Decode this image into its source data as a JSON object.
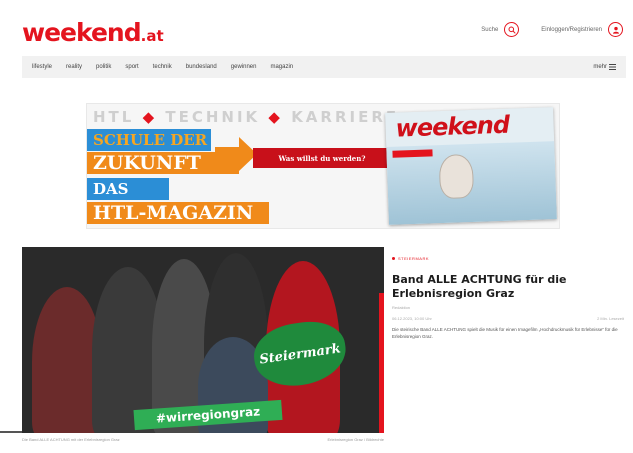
{
  "header": {
    "logo_main": "weekend",
    "logo_tld": ".at",
    "search_label": "Suche",
    "login_label": "Einloggen/Registrieren"
  },
  "nav": {
    "items": [
      "lifestyle",
      "reality",
      "politik",
      "sport",
      "technik",
      "bundesland",
      "gewinnen",
      "magazin"
    ],
    "more_label": "mehr"
  },
  "banner": {
    "top_line": [
      "HTL",
      "TECHNIK",
      "KARRIERE"
    ],
    "line1": "SCHULE DER",
    "line2": "ZUKUNFT",
    "line3": "DAS",
    "line4": "HTL-MAGAZIN",
    "cta": "Was willst du werden?",
    "magazine_logo": "weekend"
  },
  "hero": {
    "heart_text": "Steiermark",
    "sign_text": "#wirregiongraz",
    "caption_left": "Die Band ALLE ACHTUNG mit der Erlebnisregion Graz",
    "caption_right": "Erlebnisregion Graz / Bildrechte"
  },
  "article": {
    "kicker": "Steiermark",
    "headline": "Band ALLE ACHTUNG für die Erlebnisregion Graz",
    "author": "Redaktion",
    "date": "06.12.2023, 10:00 Uhr",
    "read_time": "2 Min. Lesezeit",
    "teaser": "Die steirische Band ALLE ACHTUNG spielt die Musik für einen Imagefilm „Hochdruckmusik für Erlebnisse“ für die Erlebnisregion Graz."
  },
  "colors": {
    "brand_red": "#e4141e",
    "nav_bg": "#f1f1f1",
    "banner_blue": "#2b8ed6",
    "banner_orange": "#f08a1a"
  }
}
